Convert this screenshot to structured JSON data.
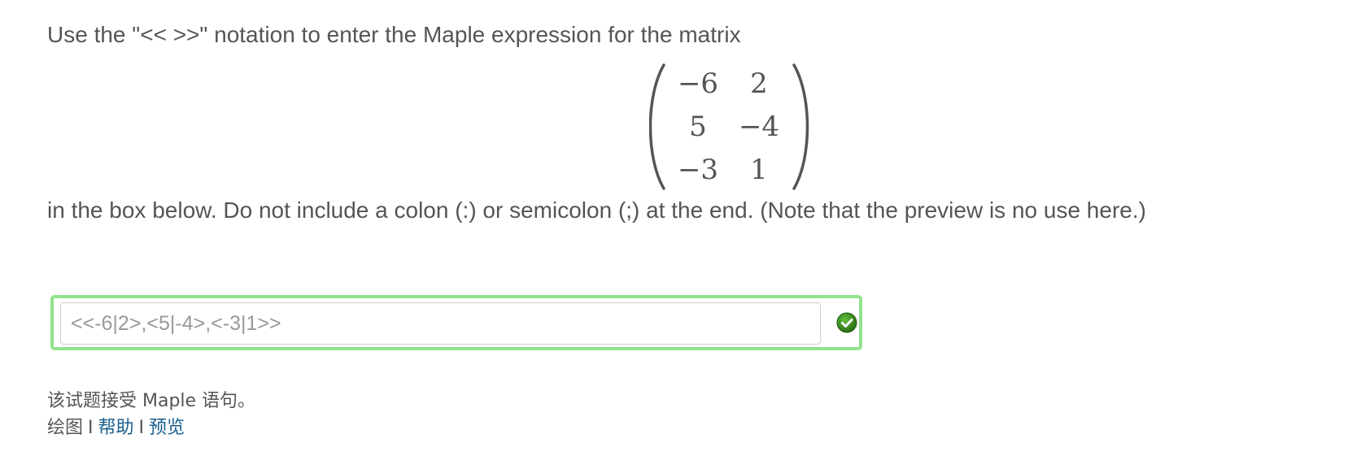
{
  "question": {
    "line1": "Use the \"<< >>\" notation to enter the Maple expression for the matrix",
    "matrix": [
      [
        "−6",
        "2"
      ],
      [
        "5",
        "−4"
      ],
      [
        "−3",
        "1"
      ]
    ],
    "line2": "in the box below.  Do not include a colon (:) or semicolon (;) at the end.  (Note that the preview is no use here.)"
  },
  "answer": {
    "value": "<<-6|2>,<5|-4>,<-3|1>>",
    "status_icon": "check-circle-icon",
    "status_color": "#3c9a1f",
    "frame_color": "#93e28d"
  },
  "footer": {
    "accept_note": "该试题接受 Maple 语句。",
    "plot_label": "绘图",
    "separator": "I",
    "help_label": "帮助",
    "preview_label": "预览",
    "link_color": "#1a5f8f"
  }
}
